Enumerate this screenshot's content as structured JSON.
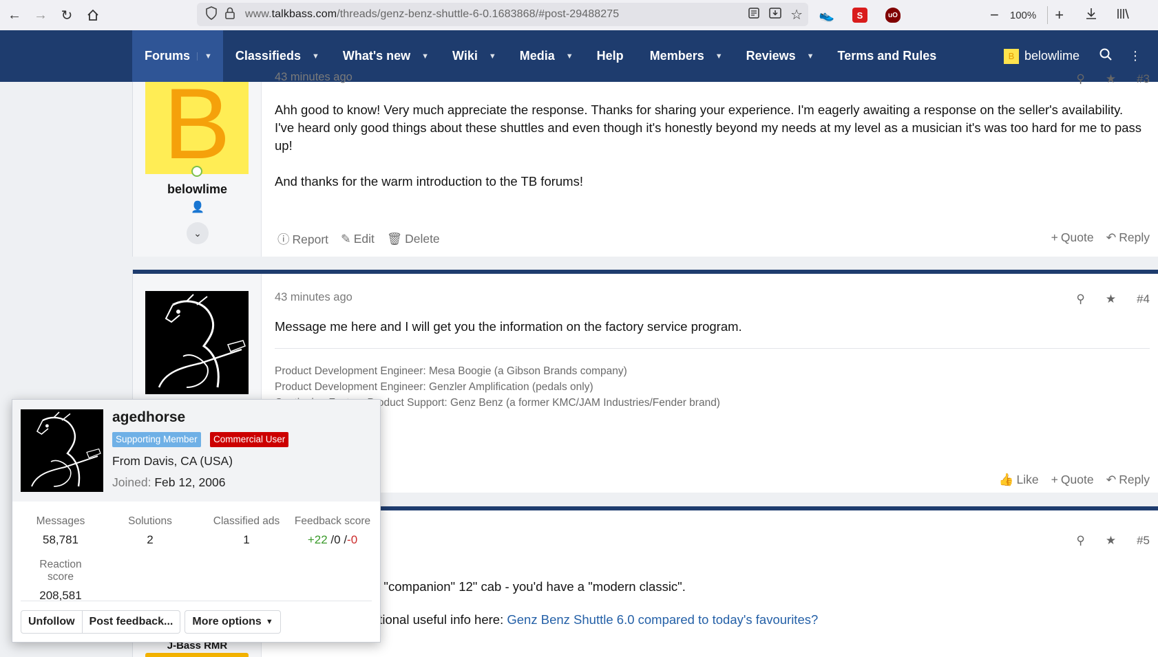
{
  "browser": {
    "url_prefix": "www.",
    "url_domain": "talkbass.com",
    "url_path": "/threads/genz-benz-shuttle-6-0.1683868/#post-29488275",
    "zoom": "100%"
  },
  "forum_nav": {
    "tabs": [
      "Forums",
      "Classifieds",
      "What's new",
      "Wiki",
      "Media",
      "Help",
      "Members",
      "Reviews",
      "Terms and Rules"
    ],
    "username": "belowlime",
    "avatar_letter": "B"
  },
  "post3": {
    "timestamp": "43 minutes ago",
    "number": "#3",
    "avatar_letter": "B",
    "username": "belowlime",
    "paragraph1": "Ahh good to know! Very much appreciate the response. Thanks for sharing your experience. I'm eagerly awaiting a response on the seller's availability. I've heard only good things about these shuttles and even though it's honestly beyond my needs at my level as a musician it's was too hard for me to pass up!",
    "paragraph2": "And thanks for the warm introduction to the TB forums!",
    "actions": {
      "report": "Report",
      "edit": "Edit",
      "delete": "Delete",
      "quote": "Quote",
      "reply": "Reply"
    }
  },
  "post4": {
    "timestamp": "43 minutes ago",
    "number": "#4",
    "message": "Message me here and I will get you the information on the factory service program.",
    "signature": [
      "Product Development Engineer: Mesa Boogie (a Gibson Brands company)",
      "Product Development Engineer: Genzler Amplification (pedals only)",
      "Continuing Factory Product Support: Genz Benz (a former KMC/JAM Industries/Fender brand)"
    ],
    "actions": {
      "like": "Like",
      "quote": "Quote",
      "reply": "Reply"
    }
  },
  "post5": {
    "number": "#5",
    "line1": "e \"companion\" 12\" cab - you'd have a \"modern classic\".",
    "line2_prefix": "litional useful info here: ",
    "link": "Genz Benz Shuttle 6.0 compared to today's favourites?",
    "side_user": "J-Bass RMR"
  },
  "member_card": {
    "username": "agedhorse",
    "badges": [
      "Supporting Member",
      "Commercial User"
    ],
    "location": "From Davis, CA (USA)",
    "joined_label": "Joined:",
    "joined_date": "Feb 12, 2006",
    "stats": [
      {
        "label": "Messages",
        "value": "58,781"
      },
      {
        "label": "Solutions",
        "value": "2"
      },
      {
        "label": "Classified ads",
        "value": "1"
      }
    ],
    "feedback": {
      "label": "Feedback score",
      "positive": "+22",
      "neutral": "0",
      "negative": "-0"
    },
    "reaction": {
      "label": "Reaction score",
      "value": "208,581"
    },
    "buttons": {
      "unfollow": "Unfollow",
      "post_feedback": "Post feedback...",
      "more_options": "More options"
    }
  },
  "colors": {
    "nav_bg": "#1e3c6e",
    "nav_active": "#2f5596",
    "badge_supporting": "#6fb0e6",
    "badge_commercial": "#cc0000",
    "feedback_positive": "#3a9a2a",
    "feedback_negative": "#cc2a2a",
    "link": "#2460a7"
  }
}
